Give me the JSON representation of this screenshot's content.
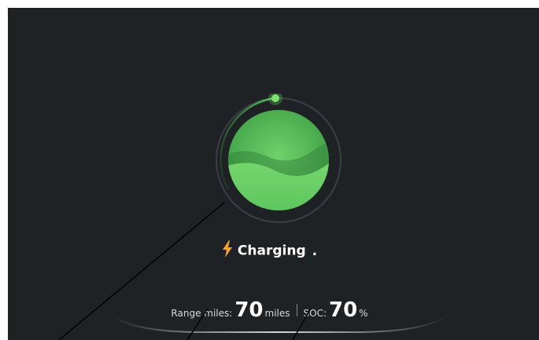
{
  "status": {
    "label": "Charging",
    "indicator": ".",
    "icon": "lightning-bolt-icon",
    "accent_color": "#f5a623"
  },
  "battery": {
    "level_fraction": 0.7,
    "fill_color": "#5cc55e",
    "ring_color": "#4fb853"
  },
  "range": {
    "label": "Range miles:",
    "value": "70",
    "unit": "miles"
  },
  "soc": {
    "label": "SOC:",
    "value": "70",
    "unit": "%"
  },
  "colors": {
    "background": "#1f2225",
    "text": "#ffffff",
    "muted_text": "#d8d8d8"
  }
}
